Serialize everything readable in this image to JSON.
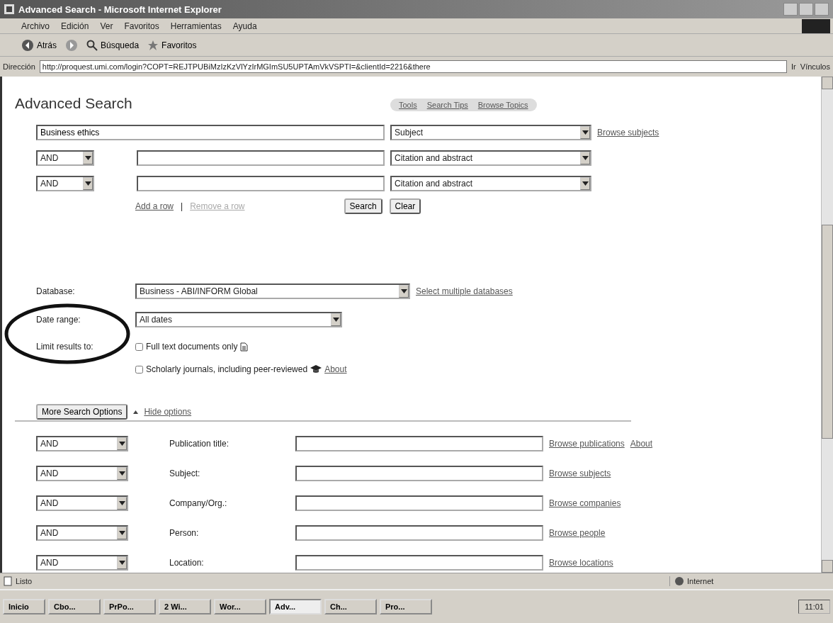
{
  "window": {
    "title": "Advanced Search - Microsoft Internet Explorer"
  },
  "menu": [
    "Archivo",
    "Edición",
    "Ver",
    "Favoritos",
    "Herramientas",
    "Ayuda"
  ],
  "toolbar": [
    {
      "kind": "back",
      "label": "Atrás"
    },
    {
      "kind": "forward"
    },
    {
      "kind": "search",
      "label": "Búsqueda"
    },
    {
      "kind": "favorites",
      "label": "Favoritos"
    }
  ],
  "address": {
    "label": "Dirección",
    "url": "http://proquest.umi.com/login?COPT=REJTPUBiMzIzKzVlYzIrMGImSU5UPTAmVkVSPTI=&clientId=2216&there",
    "go": "Ir",
    "links": "Vínculos"
  },
  "page": {
    "heading": "Advanced Search",
    "tabs": [
      {
        "label": "Tools",
        "selected": false
      },
      {
        "label": "Search Tips",
        "selected": false
      },
      {
        "label": "Browse Topics",
        "selected": false
      }
    ],
    "basic_rows": [
      {
        "value": "Business ethics",
        "field": "Subject",
        "link": "Browse subjects"
      },
      {
        "operator": "AND",
        "value": "",
        "field": "Citation and abstract"
      },
      {
        "operator": "AND",
        "value": "",
        "field": "Citation and abstract"
      }
    ],
    "row_separator": "|",
    "row_links": [
      {
        "label": "Add a row",
        "disabled": false
      },
      {
        "label": "Remove a row",
        "disabled": true
      }
    ],
    "buttons": [
      "Search",
      "Clear"
    ],
    "database": {
      "label": "Database:",
      "value": "Business - ABI/INFORM Global",
      "link": "Select multiple databases"
    },
    "date_range": {
      "label": "Date range:",
      "value": "All dates"
    },
    "limits": {
      "label": "Limit results to:",
      "options": [
        {
          "label": "Full text documents only",
          "checked": false,
          "kind": "document"
        },
        {
          "label": "Scholarly journals, including peer-reviewed",
          "checked": false,
          "kind": "mortarboard",
          "link": "About"
        }
      ]
    },
    "more_options": {
      "button": "More Search Options",
      "link": "Hide options"
    },
    "field_rows": [
      {
        "operator": "AND",
        "label": "Publication title:",
        "links": [
          "Browse publications",
          "About"
        ]
      },
      {
        "operator": "AND",
        "label": "Subject:",
        "links": [
          "Browse subjects"
        ]
      },
      {
        "operator": "AND",
        "label": "Company/Org.:",
        "links": [
          "Browse companies"
        ]
      },
      {
        "operator": "AND",
        "label": "Person:",
        "links": [
          "Browse people"
        ]
      },
      {
        "operator": "AND",
        "label": "Location:",
        "links": [
          "Browse locations"
        ]
      }
    ]
  },
  "status_bar": {
    "text": "Listo",
    "zone": "Internet"
  },
  "taskbar": {
    "start": "Inicio",
    "items": [
      {
        "label": "Cbo...",
        "selected": false
      },
      {
        "label": "PrPo...",
        "selected": false
      },
      {
        "label": "2 Wi...",
        "selected": false
      },
      {
        "label": "Wor...",
        "selected": false
      },
      {
        "label": "Adv...",
        "selected": true
      },
      {
        "label": "Ch...",
        "selected": false
      },
      {
        "label": "Pro...",
        "selected": false
      }
    ],
    "clock": "11:01"
  }
}
